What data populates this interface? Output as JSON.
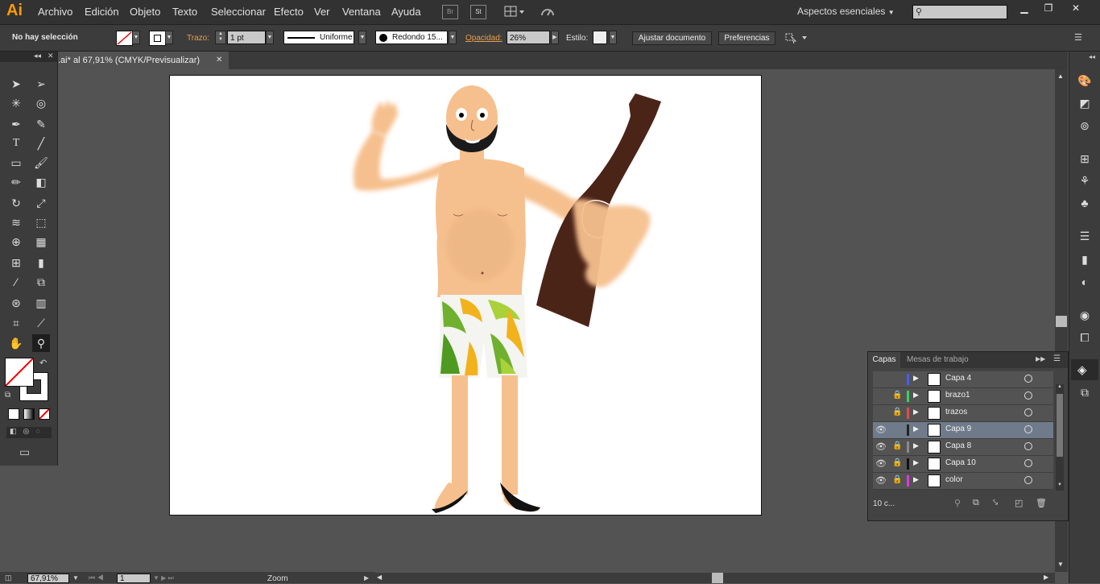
{
  "app": {
    "logo": "Ai"
  },
  "menu": [
    "Archivo",
    "Edición",
    "Objeto",
    "Texto",
    "Seleccionar",
    "Efecto",
    "Ver",
    "Ventana",
    "Ayuda"
  ],
  "menubar_icons": {
    "bridge": "Br",
    "stock": "St"
  },
  "workspace": {
    "label": "Aspectos esenciales"
  },
  "window_controls": {
    "minimize": "▁",
    "restore": "❐",
    "close": "✕"
  },
  "control_bar": {
    "selection": "No hay selección",
    "stroke_label": "Trazo:",
    "stroke_weight": "1 pt",
    "profile": "Uniforme",
    "brush": "Redondo 15...",
    "opacity_label": "Opacidad:",
    "opacity_value": "26%",
    "style_label": "Estilo:",
    "adjust_button": "Ajustar documento",
    "prefs_button": "Preferencias"
  },
  "document": {
    "tab_title": ".ai* al 67,91% (CMYK/Previsualizar)",
    "close": "✕"
  },
  "status": {
    "zoom_value": "67,91%",
    "page": "1",
    "tool_label": "Zoom"
  },
  "layers_panel": {
    "tab_layers": "Capas",
    "tab_artboards": "Mesas de trabajo",
    "count": "10 c...",
    "layers": [
      {
        "name": "Capa 4",
        "visible": false,
        "locked": false,
        "color": "#4a5cf0",
        "selected": false
      },
      {
        "name": "brazo1",
        "visible": false,
        "locked": true,
        "color": "#3ad35a",
        "selected": false
      },
      {
        "name": "trazos",
        "visible": false,
        "locked": true,
        "color": "#e34b4b",
        "selected": false
      },
      {
        "name": "Capa 9",
        "visible": true,
        "locked": false,
        "color": "#222222",
        "selected": true
      },
      {
        "name": "Capa 8",
        "visible": true,
        "locked": true,
        "color": "#8a8a8a",
        "selected": false
      },
      {
        "name": "Capa 10",
        "visible": true,
        "locked": true,
        "color": "#111111",
        "selected": false
      },
      {
        "name": "color",
        "visible": true,
        "locked": true,
        "color": "#d93cd9",
        "selected": false
      }
    ]
  },
  "colors": {
    "brand": "#ff9a00",
    "skin": "#f6c08e",
    "bottle": "#4b2418",
    "beard": "#1a1a1a",
    "shorts_green": "#6fb02e",
    "shorts_yellow": "#f2b21c"
  }
}
